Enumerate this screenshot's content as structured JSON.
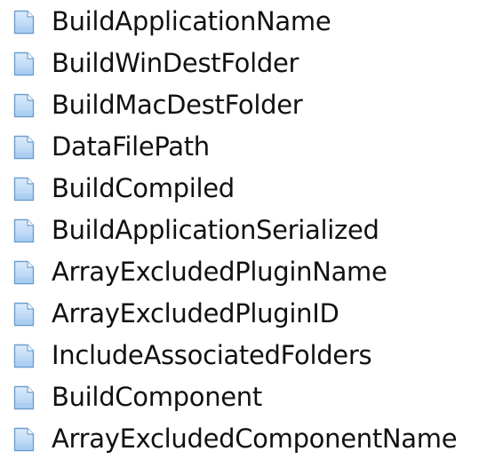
{
  "items": [
    {
      "label": "BuildApplicationName",
      "icon": "document-icon"
    },
    {
      "label": "BuildWinDestFolder",
      "icon": "document-icon"
    },
    {
      "label": "BuildMacDestFolder",
      "icon": "document-icon"
    },
    {
      "label": "DataFilePath",
      "icon": "document-icon"
    },
    {
      "label": "BuildCompiled",
      "icon": "document-icon"
    },
    {
      "label": "BuildApplicationSerialized",
      "icon": "document-icon"
    },
    {
      "label": "ArrayExcludedPluginName",
      "icon": "document-icon"
    },
    {
      "label": "ArrayExcludedPluginID",
      "icon": "document-icon"
    },
    {
      "label": "IncludeAssociatedFolders",
      "icon": "document-icon"
    },
    {
      "label": "BuildComponent",
      "icon": "document-icon"
    },
    {
      "label": "ArrayExcludedComponentName",
      "icon": "document-icon"
    }
  ],
  "colors": {
    "icon_fill_top": "#dcecfb",
    "icon_fill_bottom": "#a9cdf2",
    "icon_border": "#6f9fd0",
    "icon_fold": "#ffffff",
    "text": "#111111"
  }
}
